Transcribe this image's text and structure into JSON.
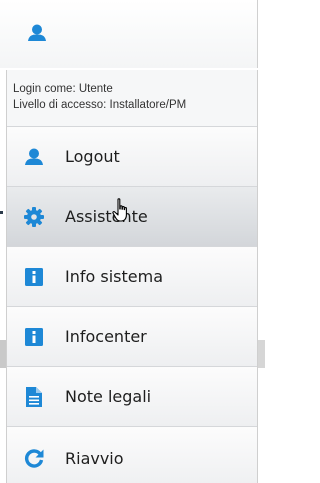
{
  "header": {
    "user_icon": "user-icon"
  },
  "login_info": {
    "login_as": "Login come: Utente",
    "access_level": "Livello di accesso: Installatore/PM"
  },
  "menu": {
    "items": [
      {
        "label": "Logout",
        "icon": "user-icon"
      },
      {
        "label": "Assistente",
        "icon": "gear-icon",
        "state": "hovered"
      },
      {
        "label": "Info sistema",
        "icon": "info-icon"
      },
      {
        "label": "Infocenter",
        "icon": "info-icon"
      },
      {
        "label": "Note legali",
        "icon": "document-icon"
      },
      {
        "label": "Riavvio",
        "icon": "refresh-icon"
      }
    ]
  },
  "colors": {
    "icon_blue": "#1e88d6",
    "menu_background": "#f3f4f5",
    "active_item": "#d9dcdf",
    "text": "#1e1e1e"
  }
}
